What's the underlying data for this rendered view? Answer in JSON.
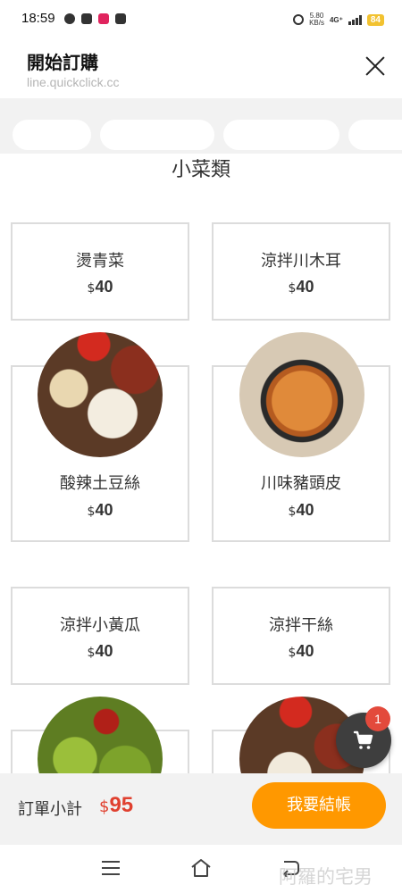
{
  "status_bar": {
    "time": "18:59",
    "net_speed_value": "5.80",
    "net_speed_unit": "KB/s",
    "network": "4G⁺",
    "battery": "84"
  },
  "header": {
    "title": "開始訂購",
    "url": "line.quickclick.cc"
  },
  "section": {
    "title": "小菜類"
  },
  "items": [
    {
      "name": "燙青菜",
      "currency": "$",
      "price": "40"
    },
    {
      "name": "涼拌川木耳",
      "currency": "$",
      "price": "40"
    },
    {
      "name": "酸辣土豆絲",
      "currency": "$",
      "price": "40"
    },
    {
      "name": "川味豬頭皮",
      "currency": "$",
      "price": "40"
    },
    {
      "name": "涼拌小黃瓜",
      "currency": "$",
      "price": "40"
    },
    {
      "name": "涼拌干絲",
      "currency": "$",
      "price": "40"
    }
  ],
  "cart": {
    "badge_count": "1"
  },
  "order_bar": {
    "subtotal_label": "訂單小計",
    "currency": "$",
    "subtotal_amount": "95",
    "checkout_label": "我要結帳"
  },
  "watermark": "阿羅的宅男",
  "colors": {
    "accent": "#ff9800",
    "price_red": "#e0402f",
    "badge_red": "#e34a3c",
    "fab": "#3e3e3e"
  }
}
